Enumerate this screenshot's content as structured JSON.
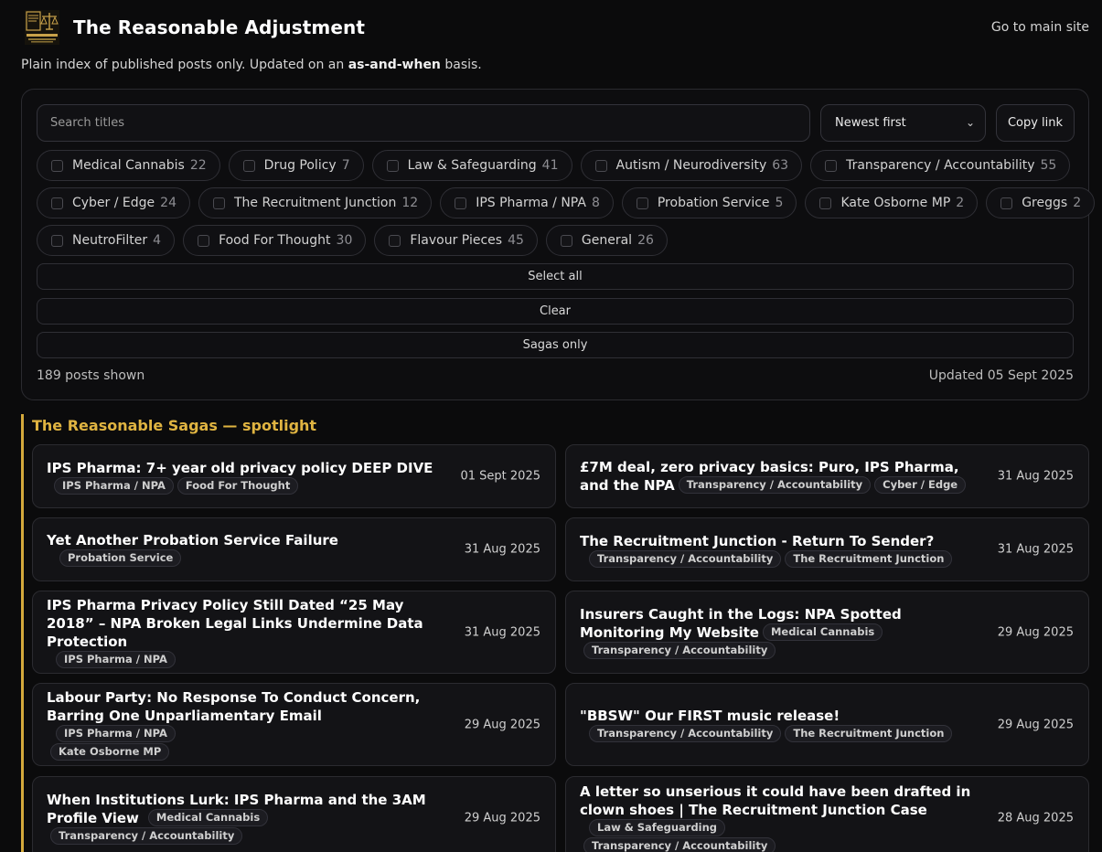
{
  "header": {
    "site_title": "The Reasonable Adjustment",
    "main_link": "Go to main site"
  },
  "intro": {
    "pre": "Plain index of published posts only. Updated on an ",
    "bold": "as-and-when",
    "post": " basis."
  },
  "filters": {
    "search_placeholder": "Search titles",
    "sort_selected": "Newest first",
    "copy_label": "Copy link",
    "chips": [
      {
        "label": "Medical Cannabis",
        "count": "22"
      },
      {
        "label": "Drug Policy",
        "count": "7"
      },
      {
        "label": "Law & Safeguarding",
        "count": "41"
      },
      {
        "label": "Autism / Neurodiversity",
        "count": "63"
      },
      {
        "label": "Transparency / Accountability",
        "count": "55"
      },
      {
        "label": "Cyber / Edge",
        "count": "24"
      },
      {
        "label": "The Recruitment Junction",
        "count": "12"
      },
      {
        "label": "IPS Pharma / NPA",
        "count": "8"
      },
      {
        "label": "Probation Service",
        "count": "5"
      },
      {
        "label": "Kate Osborne MP",
        "count": "2"
      },
      {
        "label": "Greggs",
        "count": "2"
      },
      {
        "label": "NeutroFilter",
        "count": "4"
      },
      {
        "label": "Food For Thought",
        "count": "30"
      },
      {
        "label": "Flavour Pieces",
        "count": "45"
      },
      {
        "label": "General",
        "count": "26"
      }
    ],
    "select_all": "Select all",
    "clear": "Clear",
    "sagas_only": "Sagas only",
    "posts_shown": "189 posts shown",
    "updated": "Updated 05 Sept 2025"
  },
  "spotlight": {
    "title": "The Reasonable Sagas — spotlight",
    "cards": [
      {
        "title": "IPS Pharma: 7+ year old privacy policy DEEP DIVE",
        "date": "01 Sept 2025",
        "tags": [
          "IPS Pharma / NPA",
          "Food For Thought"
        ]
      },
      {
        "title": "£7M deal, zero privacy basics: Puro, IPS Pharma, and the NPA",
        "date": "31 Aug 2025",
        "tags": [
          "Transparency / Accountability",
          "Cyber / Edge"
        ]
      },
      {
        "title": "Yet Another Probation Service Failure",
        "date": "31 Aug 2025",
        "tags": [
          "Probation Service"
        ]
      },
      {
        "title": "The Recruitment Junction - Return To Sender?",
        "date": "31 Aug 2025",
        "tags": [
          "Transparency / Accountability",
          "The Recruitment Junction"
        ]
      },
      {
        "title": "IPS Pharma Privacy Policy Still Dated “25 May 2018” – NPA Broken Legal Links Undermine Data Protection",
        "date": "31 Aug 2025",
        "tags": [
          "IPS Pharma / NPA"
        ]
      },
      {
        "title": "Insurers Caught in the Logs: NPA Spotted Monitoring My Website",
        "date": "29 Aug 2025",
        "tags": [
          "Medical Cannabis",
          "Transparency / Accountability"
        ]
      },
      {
        "title": "Labour Party: No Response To Conduct Concern, Barring One Unparliamentary Email",
        "date": "29 Aug 2025",
        "tags": [
          "IPS Pharma / NPA",
          "Kate Osborne MP"
        ]
      },
      {
        "title": "\"BBSW\" Our FIRST music release!",
        "date": "29 Aug 2025",
        "tags": [
          "Transparency / Accountability",
          "The Recruitment Junction"
        ]
      },
      {
        "title": "When Institutions Lurk: IPS Pharma and the 3AM Profile View",
        "date": "29 Aug 2025",
        "tags": [
          "Medical Cannabis",
          "Transparency / Accountability"
        ]
      },
      {
        "title": "A letter so unserious it could have been drafted in clown shoes | The Recruitment Junction Case",
        "date": "28 Aug 2025",
        "tags": [
          "Law & Safeguarding",
          "Transparency / Accountability"
        ]
      }
    ]
  },
  "colors": {
    "background": "#0b0b0c",
    "accent": "#d4a93c",
    "spotlight_title": "#e0b441"
  },
  "icons": {
    "logo": "scales-of-justice-logo",
    "sort": "chevron-down-icon"
  }
}
